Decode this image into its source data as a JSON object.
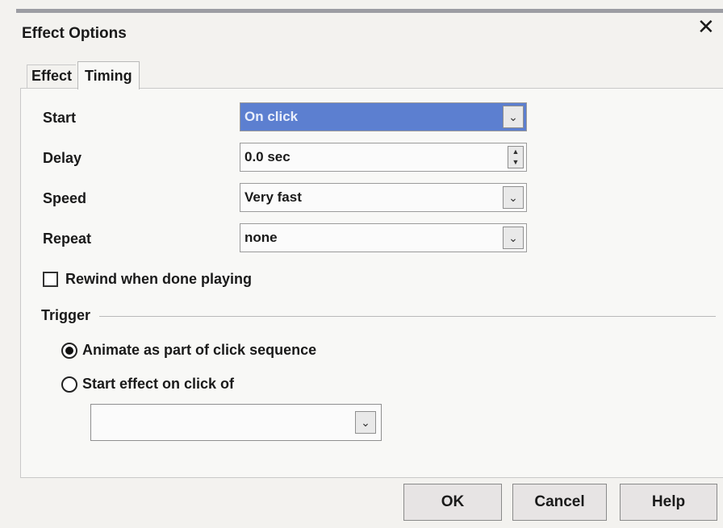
{
  "dialog": {
    "title": "Effect Options",
    "close_glyph": "✕"
  },
  "tabs": [
    {
      "label": "Effect",
      "active": false
    },
    {
      "label": "Timing",
      "active": true
    }
  ],
  "fields": {
    "start": {
      "label": "Start",
      "value": "On click"
    },
    "delay": {
      "label": "Delay",
      "value": "0.0 sec"
    },
    "speed": {
      "label": "Speed",
      "value": "Very fast"
    },
    "repeat": {
      "label": "Repeat",
      "value": "none"
    }
  },
  "rewind": {
    "label": "Rewind when done playing",
    "checked": false
  },
  "trigger": {
    "label": "Trigger",
    "options": [
      {
        "label": "Animate as part of click sequence",
        "selected": true
      },
      {
        "label": "Start effect on click of",
        "selected": false
      }
    ],
    "target_value": ""
  },
  "buttons": {
    "ok": "OK",
    "cancel": "Cancel",
    "help": "Help"
  },
  "colors": {
    "selection": "#5c7fd0",
    "background": "#f3f2ef"
  },
  "icons": {
    "dropdown": "chevron-down-icon",
    "spinner": "spinner-arrows-icon",
    "close": "close-icon"
  }
}
